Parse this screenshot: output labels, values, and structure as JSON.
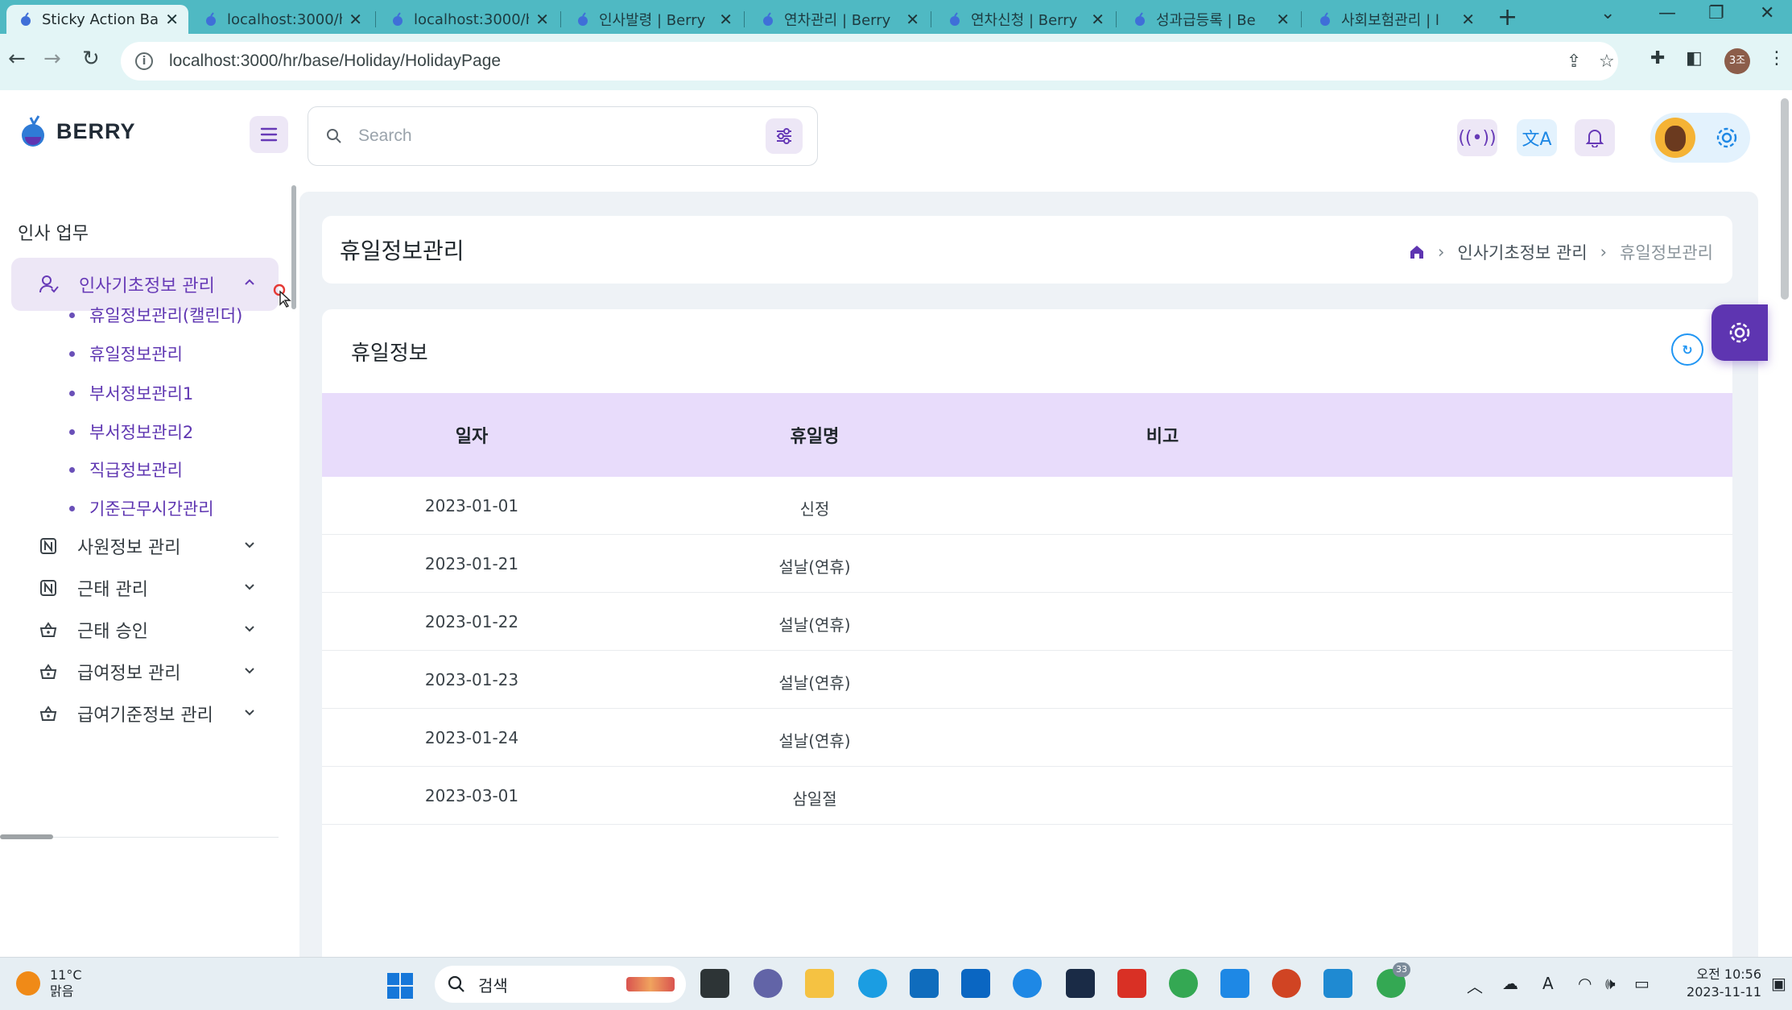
{
  "browser": {
    "tabs": [
      {
        "title": "Sticky Action Ba",
        "active": true
      },
      {
        "title": "localhost:3000/h",
        "active": false
      },
      {
        "title": "localhost:3000/h",
        "active": false
      },
      {
        "title": "인사발령 | Berry",
        "active": false
      },
      {
        "title": "연차관리 | Berry",
        "active": false
      },
      {
        "title": "연차신청 | Berry",
        "active": false
      },
      {
        "title": "성과급등록 | Be",
        "active": false
      },
      {
        "title": "사회보험관리 | l",
        "active": false
      }
    ],
    "url": "localhost:3000/hr/base/Holiday/HolidayPage",
    "profile_initials": "3조"
  },
  "app": {
    "brand": "BERRY",
    "search_placeholder": "Search"
  },
  "sidebar": {
    "caption": "인사 업무",
    "expanded_group": {
      "label": "인사기초정보 관리",
      "children": [
        "휴일정보관리(캘린더)",
        "휴일정보관리",
        "부서정보관리1",
        "부서정보관리2",
        "직급정보관리",
        "기준근무시간관리"
      ]
    },
    "groups": [
      "사원정보 관리",
      "근태 관리",
      "근태 승인",
      "급여정보 관리",
      "급여기준정보 관리"
    ]
  },
  "page": {
    "title": "휴일정보관리",
    "breadcrumb": [
      "인사기초정보 관리",
      "휴일정보관리"
    ]
  },
  "card": {
    "title": "휴일정보",
    "columns": [
      "일자",
      "휴일명",
      "비고"
    ],
    "rows": [
      {
        "date": "2023-01-01",
        "name": "신정",
        "note": ""
      },
      {
        "date": "2023-01-21",
        "name": "설날(연휴)",
        "note": ""
      },
      {
        "date": "2023-01-22",
        "name": "설날(연휴)",
        "note": ""
      },
      {
        "date": "2023-01-23",
        "name": "설날(연휴)",
        "note": ""
      },
      {
        "date": "2023-01-24",
        "name": "설날(연휴)",
        "note": ""
      },
      {
        "date": "2023-03-01",
        "name": "삼일절",
        "note": ""
      }
    ]
  },
  "taskbar": {
    "temperature": "11°C",
    "weather": "맑음",
    "search_label": "검색",
    "time": "오전 10:56",
    "date": "2023-11-11",
    "chrome_badge": "33"
  },
  "colors": {
    "primary": "#673ab7",
    "primary_dark": "#5e35b1",
    "primary_light": "#ede7f6",
    "secondary_light": "#e3f2fd",
    "table_header": "#e8dcfb",
    "tab_strip": "#4fb9c3"
  }
}
